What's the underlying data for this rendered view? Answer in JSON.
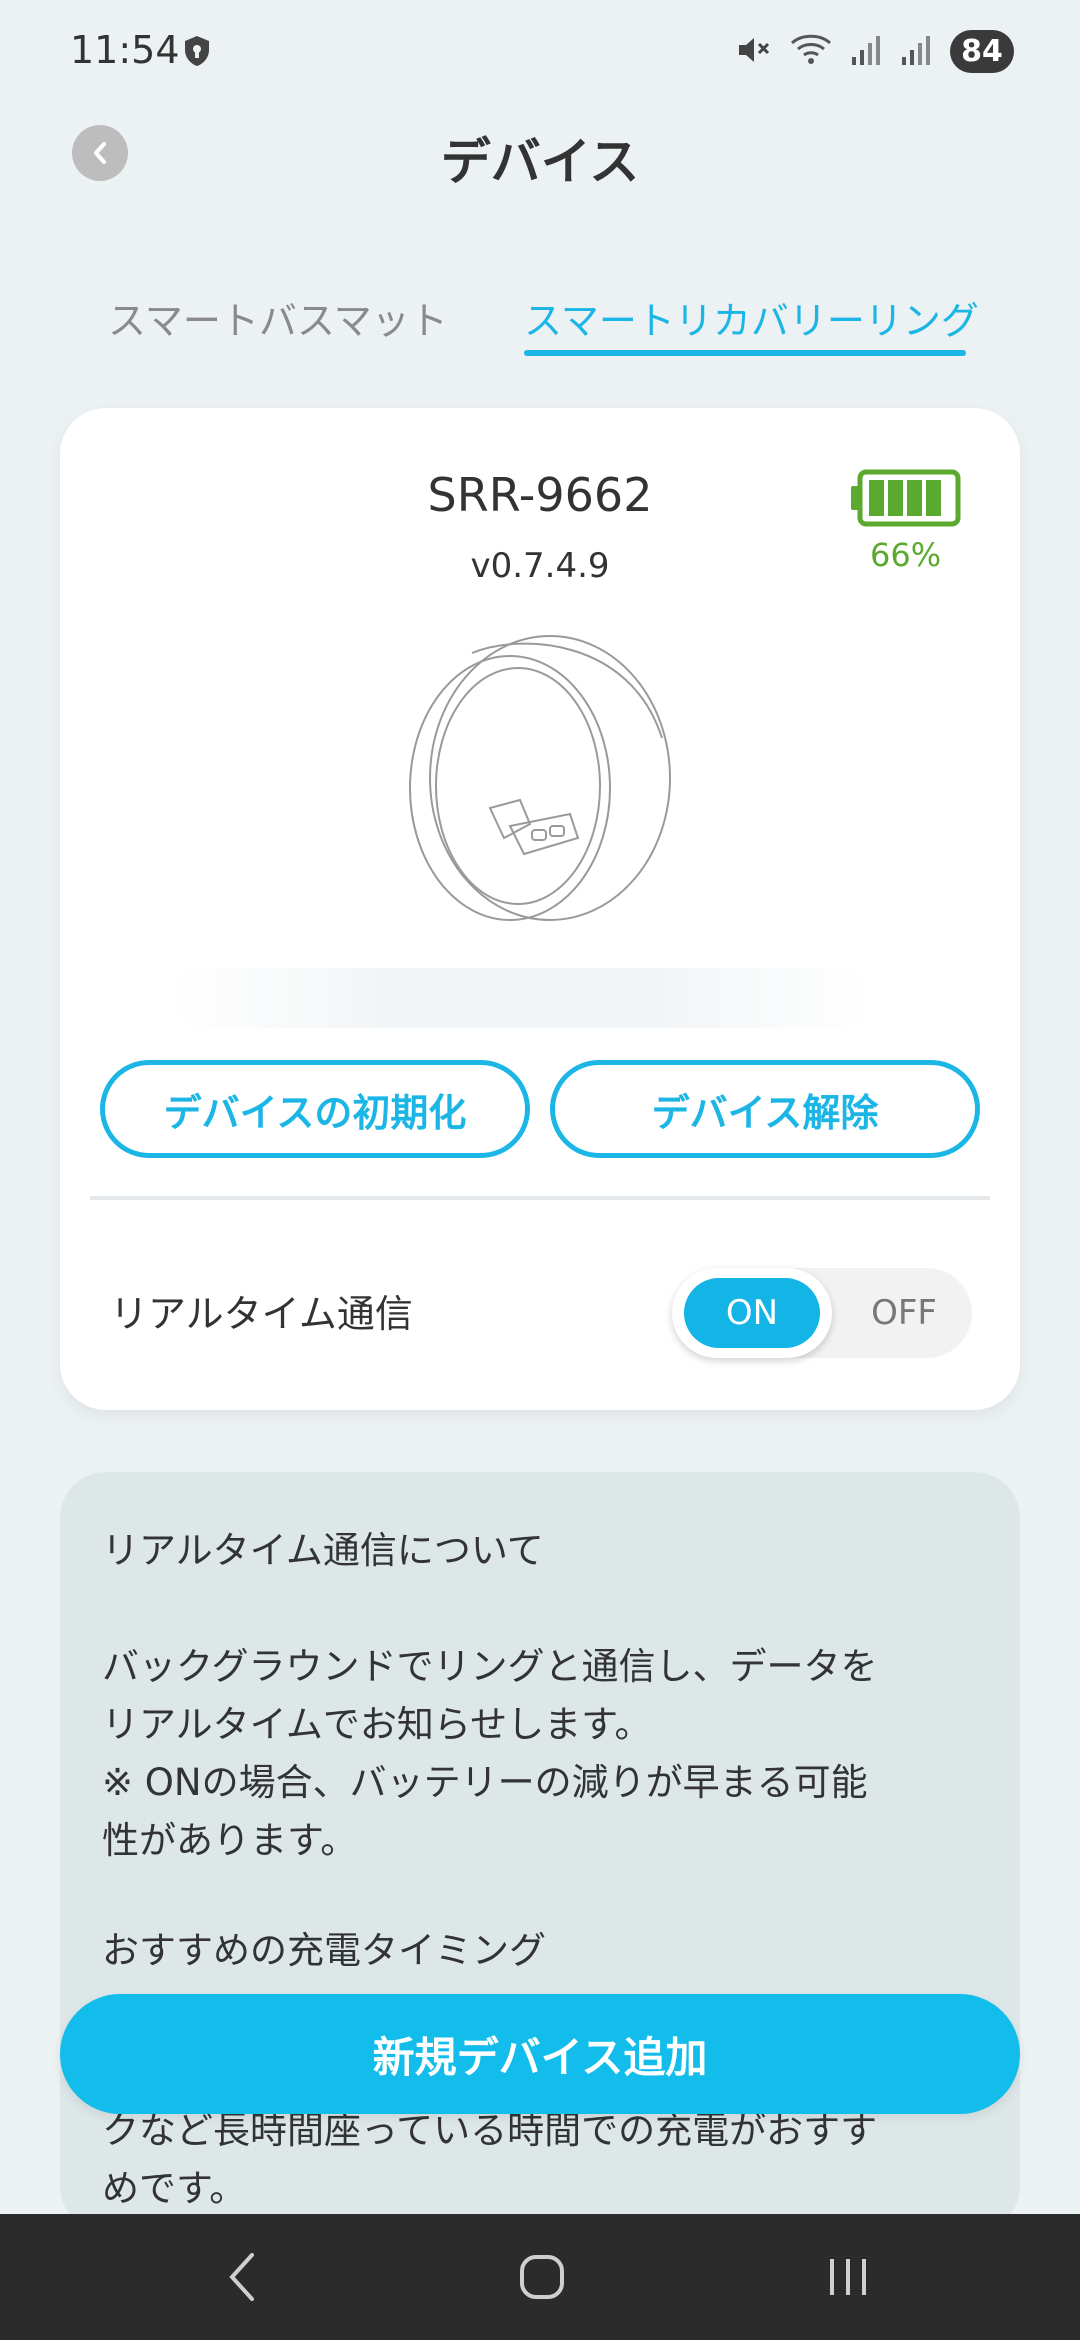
{
  "status_bar": {
    "time": "11:54",
    "battery_level": "84"
  },
  "header": {
    "title": "デバイス"
  },
  "tabs": [
    {
      "label": "スマートバスマット",
      "active": false
    },
    {
      "label": "スマートリカバリーリング",
      "active": true
    }
  ],
  "device": {
    "name": "SRR-9662",
    "version": "v0.7.4.9",
    "battery_percent": "66%",
    "battery_fraction": 0.66,
    "reset_button": "デバイスの初期化",
    "release_button": "デバイス解除",
    "realtime_label": "リアルタイム通信",
    "toggle_on": "ON",
    "toggle_off": "OFF",
    "toggle_state": "ON"
  },
  "info": {
    "title": "リアルタイム通信について",
    "body1_line1": "バックグラウンドでリングと通信し、データを",
    "body1_line2": "リアルタイムでお知らせします。",
    "body2_line1": "※ ONの場合、バッテリーの減りが早まる可能",
    "body2_line2": "性があります。",
    "subtitle": "おすすめの充電タイミング",
    "tail_line1": "クなど長時間座っている時間での充電がおすす",
    "tail_line2": "めです。"
  },
  "add_device_button": "新規デバイス追加",
  "colors": {
    "accent": "#12BDEB",
    "battery_green": "#5BAA2F",
    "background": "#ECF1F3",
    "info_panel": "#DDE7E8"
  }
}
